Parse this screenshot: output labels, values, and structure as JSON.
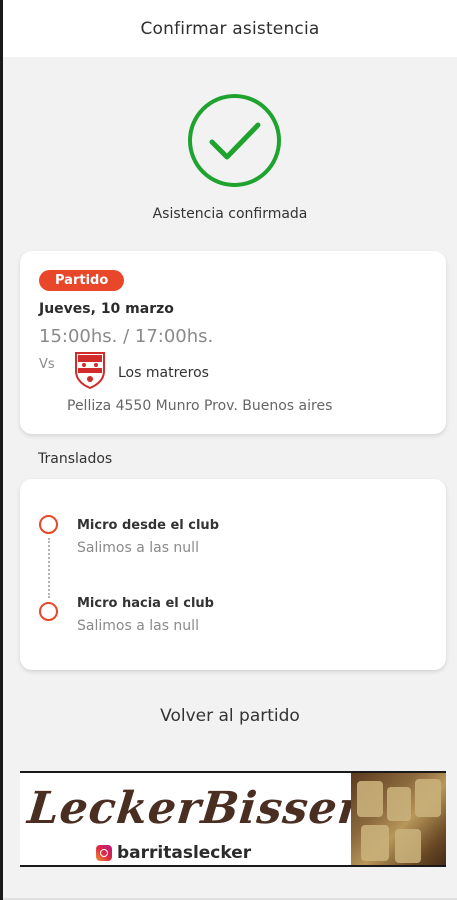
{
  "header": {
    "title": "Confirmar asistencia"
  },
  "status": {
    "text": "Asistencia confirmada",
    "color": "#1fa32f",
    "icon": "checkmark-icon"
  },
  "match": {
    "badge": "Partido",
    "badge_color": "#e8472a",
    "date": "Jueves, 10 marzo",
    "time": "15:00hs. / 17:00hs.",
    "vs": "Vs",
    "opponent": "Los matreros",
    "address": "Pelliza 4550 Munro Prov. Buenos aires"
  },
  "transfers": {
    "label": "Translados",
    "items": [
      {
        "title": "Micro desde el club",
        "subtitle": "Salimos a las null"
      },
      {
        "title": "Micro hacia el club",
        "subtitle": "Salimos a las  null"
      }
    ]
  },
  "back_link": "Volver al partido",
  "ad": {
    "brand": "LeckerBissen",
    "instagram": "barritaslecker"
  }
}
